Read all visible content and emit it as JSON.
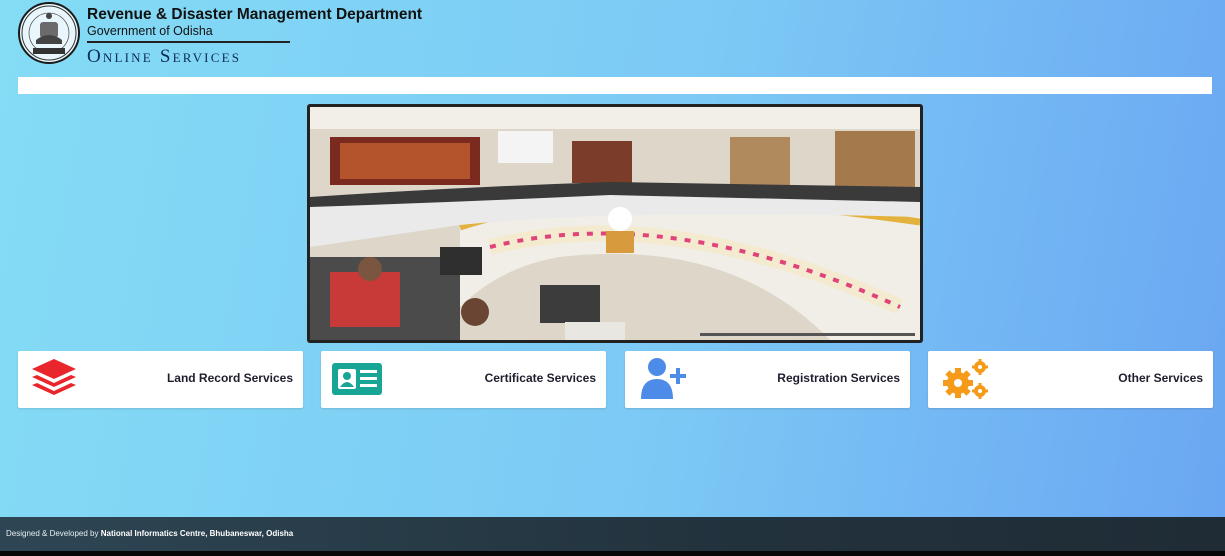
{
  "header": {
    "department": "Revenue & Disaster Management Department",
    "government": "Government of Odisha",
    "portal": "Online Services"
  },
  "slider": {
    "active_slide_photo": "conference-room-meeting-photo"
  },
  "services": [
    {
      "label": "Land Record Services",
      "icon": "layers-icon",
      "color": "#e8262b"
    },
    {
      "label": "Certificate Services",
      "icon": "id-card-icon",
      "color": "#18a596"
    },
    {
      "label": "Registration Services",
      "icon": "user-plus-icon",
      "color": "#4c8be8"
    },
    {
      "label": "Other Services",
      "icon": "gears-icon",
      "color": "#f59b19"
    }
  ],
  "footer": {
    "prefix": "Designed & Developed by ",
    "org": "National Informatics Centre, Bhubaneswar, Odisha"
  }
}
